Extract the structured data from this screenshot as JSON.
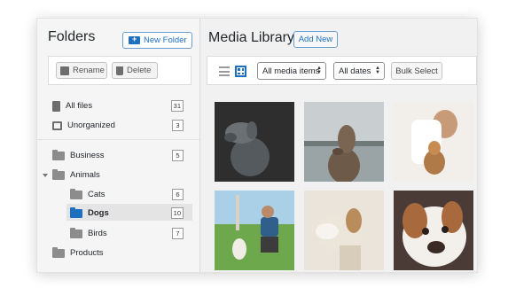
{
  "folders": {
    "title": "Folders",
    "new_folder_label": "New Folder",
    "rename_label": "Rename",
    "delete_label": "Delete",
    "items": [
      {
        "label": "All files",
        "count": "31",
        "icon": "file-icon"
      },
      {
        "label": "Unorganized",
        "count": "3",
        "icon": "box-icon"
      },
      {
        "label": "Business",
        "count": "5",
        "icon": "folder-icon"
      },
      {
        "label": "Animals",
        "count": "",
        "icon": "folder-icon"
      },
      {
        "label": "Cats",
        "count": "6",
        "icon": "folder-icon"
      },
      {
        "label": "Dogs",
        "count": "10",
        "icon": "folder-icon",
        "selected": true
      },
      {
        "label": "Birds",
        "count": "7",
        "icon": "folder-icon"
      },
      {
        "label": "Products",
        "count": "",
        "icon": "folder-icon"
      }
    ]
  },
  "media": {
    "title": "Media Library",
    "add_new_label": "Add New",
    "type_filter": "All media items",
    "date_filter": "All dates",
    "bulk_select_label": "Bulk Select"
  },
  "colors": {
    "accent": "#1e6fbf",
    "selected_row": "#e4e4e4"
  }
}
